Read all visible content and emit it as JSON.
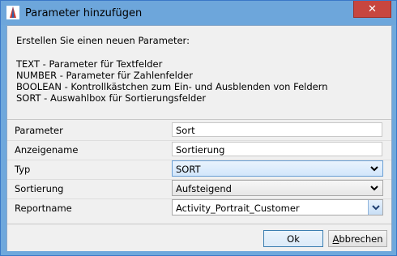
{
  "window": {
    "title": "Parameter hinzufügen",
    "close_glyph": "✕"
  },
  "info": {
    "heading": "Erstellen Sie einen neuen Parameter:",
    "lines": [
      "TEXT - Parameter für Textfelder",
      "NUMBER - Parameter für Zahlenfelder",
      "BOOLEAN - Kontrollkästchen zum Ein- und Ausblenden von Feldern",
      "SORT - Auswahlbox für Sortierungsfelder"
    ]
  },
  "form": {
    "parameter": {
      "label": "Parameter",
      "value": "Sort"
    },
    "anzeigename": {
      "label": "Anzeigename",
      "value": "Sortierung"
    },
    "typ": {
      "label": "Typ",
      "value": "SORT"
    },
    "sortierung": {
      "label": "Sortierung",
      "value": "Aufsteigend"
    },
    "reportname": {
      "label": "Reportname",
      "value": "Activity_Portrait_Customer"
    }
  },
  "buttons": {
    "ok": "Ok",
    "cancel_first": "A",
    "cancel_rest": "bbrechen"
  },
  "colors": {
    "titlebar": "#6da6db",
    "close": "#c7463f",
    "dialog_bg": "#f0f0f0"
  }
}
